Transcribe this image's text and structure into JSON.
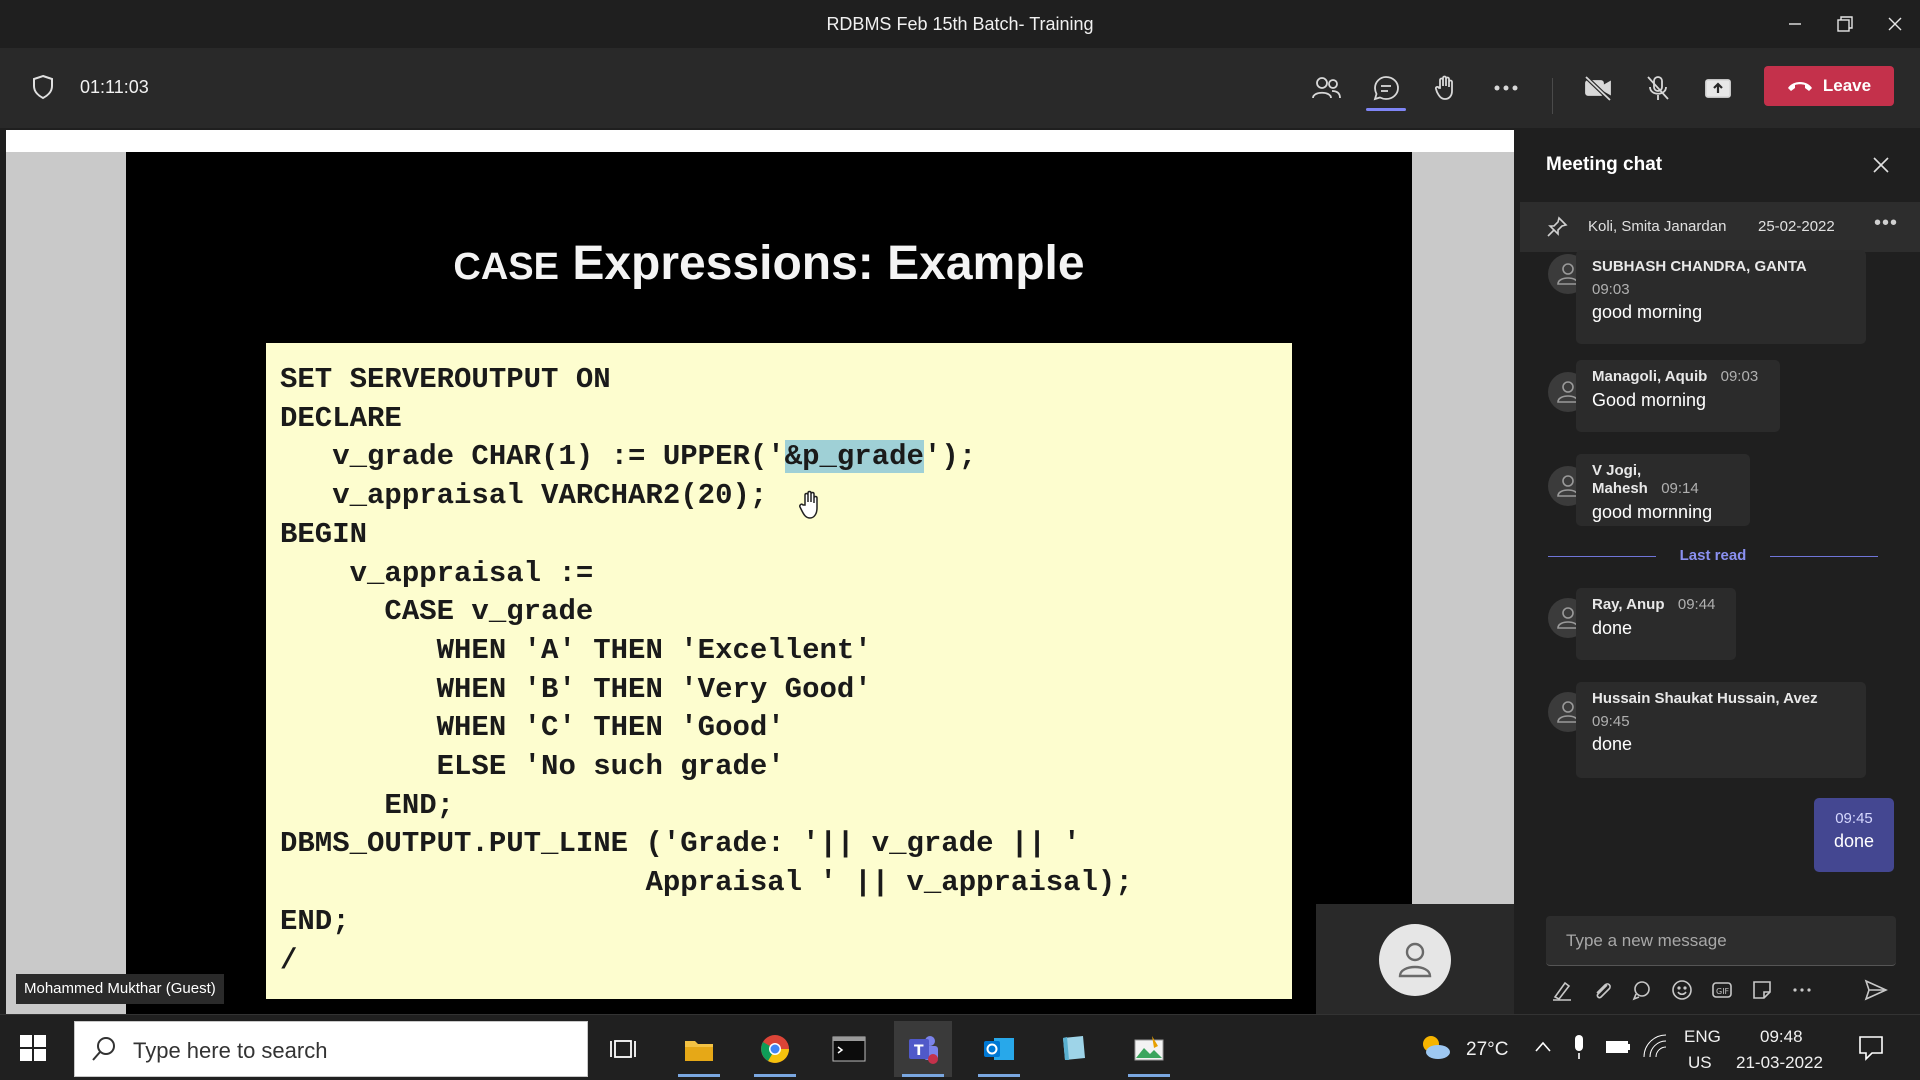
{
  "window": {
    "title": "RDBMS Feb 15th Batch- Training"
  },
  "toolbar": {
    "timer": "01:11:03",
    "leave_label": "Leave"
  },
  "slide": {
    "title_smallcaps": "CASE",
    "title_rest": " Expressions: Example",
    "code_lines": [
      "SET SERVEROUTPUT ON",
      "DECLARE",
      "   v_grade CHAR(1) := UPPER('",
      "   v_appraisal VARCHAR2(20);",
      "BEGIN",
      "    v_appraisal :=",
      "      CASE v_grade",
      "         WHEN 'A' THEN 'Excellent'",
      "         WHEN 'B' THEN 'Very Good'",
      "         WHEN 'C' THEN 'Good'",
      "         ELSE 'No such grade'",
      "      END;",
      "DBMS_OUTPUT.PUT_LINE ('Grade: '|| v_grade || '",
      "                     Appraisal ' || v_appraisal);",
      "END;",
      "/"
    ],
    "highlighted_token": "&p_grade",
    "after_highlight": "');"
  },
  "stage": {
    "presenter_label": "Mohammed Mukthar (Guest)"
  },
  "chat": {
    "title": "Meeting chat",
    "pinned": {
      "author": "Koli, Smita Janardan",
      "date": "25-02-2022"
    },
    "messages": [
      {
        "name": "SUBHASH CHANDRA, GANTA",
        "time": "09:03",
        "text": "good morning"
      },
      {
        "name": "Managoli, Aquib",
        "time": "09:03",
        "text": "Good morning"
      },
      {
        "name": "V Jogi, Mahesh",
        "time": "09:14",
        "text": "good mornning"
      },
      {
        "name": "Ray, Anup",
        "time": "09:44",
        "text": "done"
      },
      {
        "name": "Hussain Shaukat Hussain, Avez",
        "time": "09:45",
        "text": "done"
      }
    ],
    "last_read_label": "Last read",
    "my_message": {
      "time": "09:45",
      "text": "done"
    },
    "compose_placeholder": "Type a new message"
  },
  "taskbar": {
    "search_placeholder": "Type here to search",
    "temperature": "27°C",
    "lang_line1": "ENG",
    "lang_line2": "US",
    "time": "09:48",
    "date": "21-03-2022"
  },
  "colors": {
    "leave": "#c4314b",
    "accent": "#7f85f5",
    "slide_code_bg": "#fdfdcf",
    "highlight": "#9fd0d6"
  }
}
